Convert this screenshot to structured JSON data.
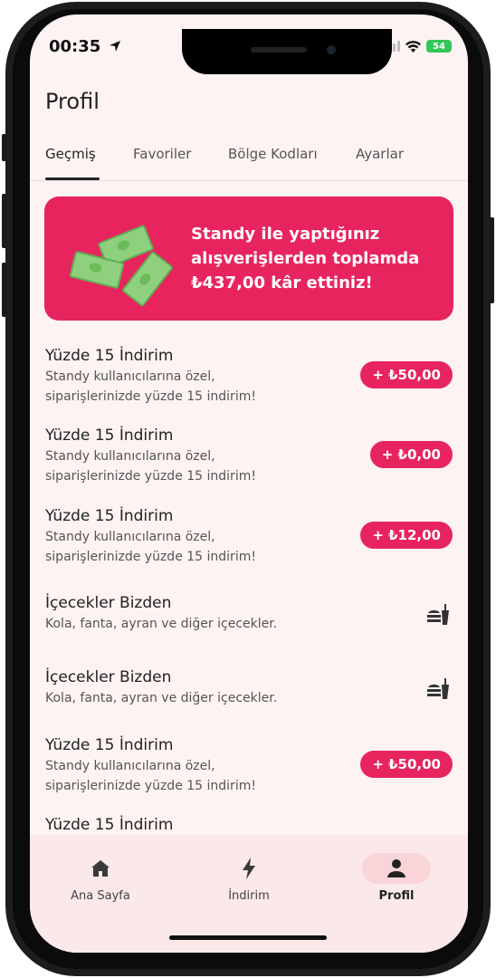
{
  "status_bar": {
    "time": "00:35",
    "battery": "54"
  },
  "header": {
    "title": "Profil"
  },
  "tabs": [
    {
      "label": "Geçmiş",
      "active": true
    },
    {
      "label": "Favoriler",
      "active": false
    },
    {
      "label": "Bölge Kodları",
      "active": false
    },
    {
      "label": "Ayarlar",
      "active": false
    }
  ],
  "banner": {
    "text": "Standy ile yaptığınız alışverişlerden toplamda ₺437,00 kâr ettiniz!"
  },
  "history": [
    {
      "title": "Yüzde 15 İndirim",
      "desc1": "Standy kullanıcılarına özel,",
      "desc2": "siparişlerinizde yüzde 15 indirim!",
      "amount": "+ ₺50,00"
    },
    {
      "title": "Yüzde 15 İndirim",
      "desc1": "Standy kullanıcılarına özel,",
      "desc2": "siparişlerinizde yüzde 15 indirim!",
      "amount": "+ ₺0,00"
    },
    {
      "title": "Yüzde 15 İndirim",
      "desc1": "Standy kullanıcılarına özel,",
      "desc2": "siparişlerinizde yüzde 15 indirim!",
      "amount": "+ ₺12,00"
    },
    {
      "title": "İçecekler Bizden",
      "desc1": "Kola, fanta, ayran ve diğer içecekler.",
      "icon": "food-drink-icon"
    },
    {
      "title": "İçecekler Bizden",
      "desc1": "Kola, fanta, ayran ve diğer içecekler.",
      "icon": "food-drink-icon"
    },
    {
      "title": "Yüzde 15 İndirim",
      "desc1": "Standy kullanıcılarına özel,",
      "desc2": "siparişlerinizde yüzde 15 indirim!",
      "amount": "+ ₺50,00"
    },
    {
      "title": "Yüzde 15 İndirim"
    }
  ],
  "bottom_nav": [
    {
      "label": "Ana Sayfa",
      "icon": "home-icon",
      "active": false
    },
    {
      "label": "İndirim",
      "icon": "lightning-icon",
      "active": false
    },
    {
      "label": "Profil",
      "icon": "person-icon",
      "active": true
    }
  ],
  "colors": {
    "accent": "#e8245f",
    "background": "#fdf3f2",
    "nav_background": "#fbe8e8",
    "active_pill": "#f9d5d9"
  }
}
